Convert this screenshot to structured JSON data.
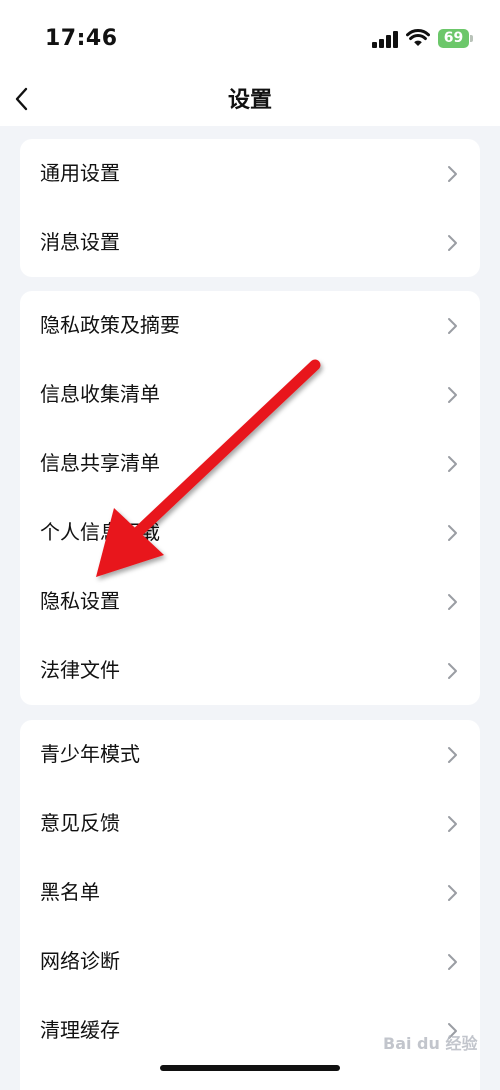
{
  "status_bar": {
    "time": "17:46",
    "battery": "69"
  },
  "nav": {
    "title": "设置"
  },
  "groups": [
    {
      "items": [
        {
          "label": "通用设置"
        },
        {
          "label": "消息设置"
        }
      ]
    },
    {
      "items": [
        {
          "label": "隐私政策及摘要"
        },
        {
          "label": "信息收集清单"
        },
        {
          "label": "信息共享清单"
        },
        {
          "label": "个人信息下载"
        },
        {
          "label": "隐私设置"
        },
        {
          "label": "法律文件"
        }
      ]
    },
    {
      "items": [
        {
          "label": "青少年模式"
        },
        {
          "label": "意见反馈"
        },
        {
          "label": "黑名单"
        },
        {
          "label": "网络诊断"
        },
        {
          "label": "清理缓存"
        }
      ]
    }
  ],
  "watermark": {
    "text": "Bai du 经验"
  },
  "colors": {
    "arrow": "#e8161d",
    "battery": "#6cc76a",
    "background": "#f2f4f8"
  }
}
